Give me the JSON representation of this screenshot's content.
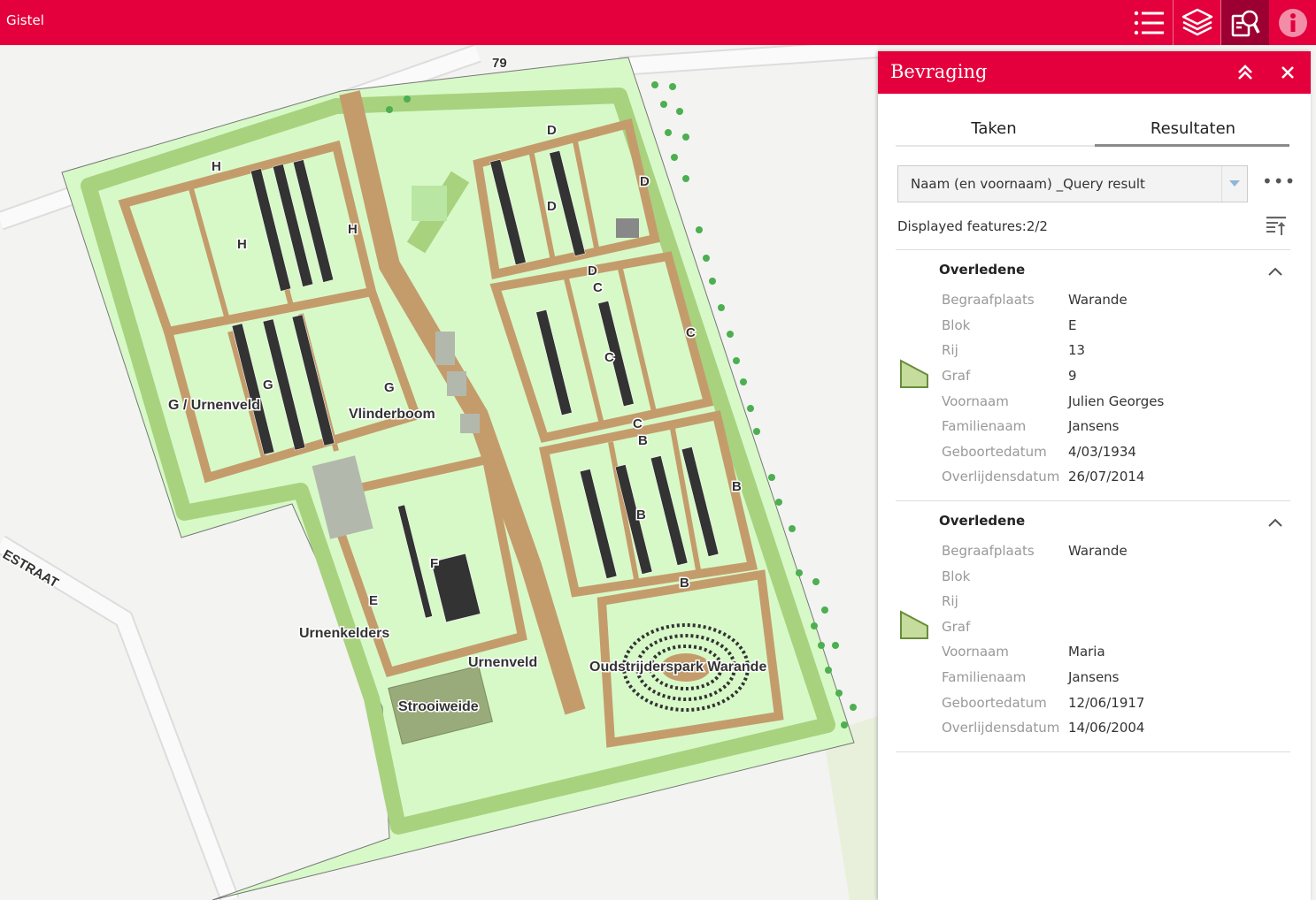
{
  "app": {
    "title": "Gistel"
  },
  "toolbar": {
    "buttons": [
      {
        "name": "legend",
        "icon": "list-icon"
      },
      {
        "name": "layers",
        "icon": "layers-icon"
      },
      {
        "name": "query",
        "icon": "query-search-icon",
        "active": true
      },
      {
        "name": "about",
        "icon": "info-icon"
      }
    ]
  },
  "colors": {
    "brand": "#e3003c",
    "brand_dark": "#9c0033",
    "grass": "#d5f8c5",
    "path": "#c49c6c",
    "hedge": "#a5cf7c"
  },
  "map": {
    "road_label": "79",
    "street_label": "ESTRAAT",
    "labels": {
      "H1": "H",
      "H2": "H",
      "H3": "H",
      "D1": "D",
      "D2": "D",
      "D3": "D",
      "D4": "D",
      "C1": "C",
      "C2": "C",
      "C3": "C",
      "C4": "C",
      "B1": "B",
      "B2": "B",
      "B3": "B",
      "B4": "B",
      "G1": "G",
      "G2": "G",
      "F": "F",
      "E": "E",
      "g_urnenveld": "G / Urnenveld",
      "vlinderboom": "Vlinderboom",
      "urnenkelders": "Urnenkelders",
      "urnenveld": "Urnenveld",
      "strooiweide": "Strooiweide",
      "oudstrijderspark": "Oudstrijderspark Warande"
    }
  },
  "panel": {
    "title": "Bevraging",
    "tabs": [
      {
        "label": "Taken"
      },
      {
        "label": "Resultaten",
        "active": true
      }
    ],
    "select": {
      "value": "Naam (en voornaam) _Query result"
    },
    "more_label": "•••",
    "displayed": "Displayed features:2/2",
    "features": [
      {
        "title": "Overledene",
        "fields": [
          {
            "label": "Begraafplaats",
            "value": "Warande"
          },
          {
            "label": "Blok",
            "value": "E"
          },
          {
            "label": "Rij",
            "value": "13"
          },
          {
            "label": "Graf",
            "value": "9"
          },
          {
            "label": "Voornaam",
            "value": "Julien Georges"
          },
          {
            "label": "Familienaam",
            "value": "Jansens"
          },
          {
            "label": "Geboortedatum",
            "value": "4/03/1934"
          },
          {
            "label": "Overlijdensdatum",
            "value": "26/07/2014"
          }
        ]
      },
      {
        "title": "Overledene",
        "fields": [
          {
            "label": "Begraafplaats",
            "value": "Warande"
          },
          {
            "label": "Blok",
            "value": ""
          },
          {
            "label": "Rij",
            "value": ""
          },
          {
            "label": "Graf",
            "value": ""
          },
          {
            "label": "Voornaam",
            "value": "Maria"
          },
          {
            "label": "Familienaam",
            "value": "Jansens"
          },
          {
            "label": "Geboortedatum",
            "value": "12/06/1917"
          },
          {
            "label": "Overlijdensdatum",
            "value": "14/06/2004"
          }
        ]
      }
    ]
  }
}
